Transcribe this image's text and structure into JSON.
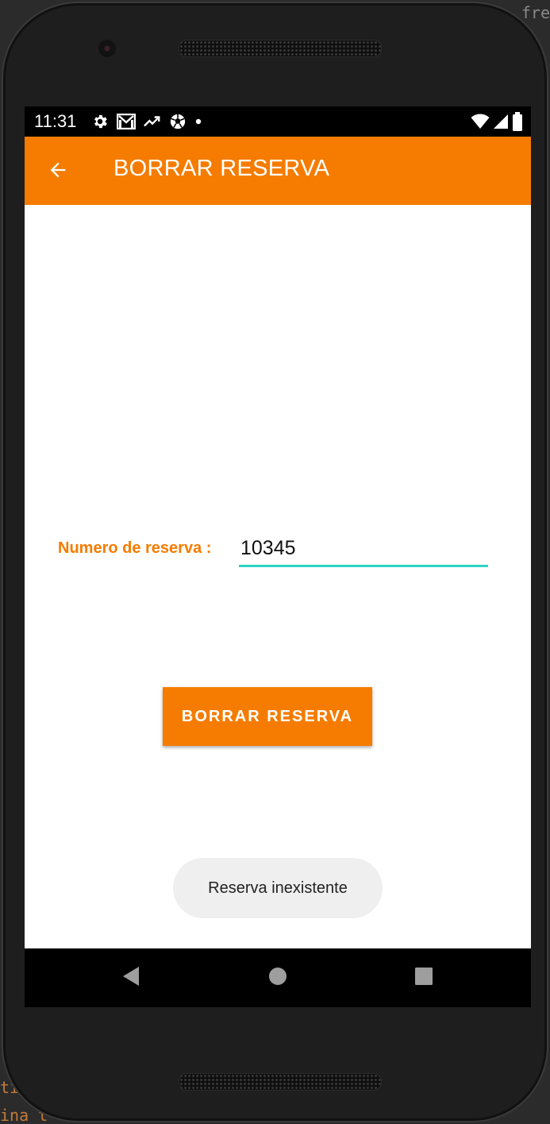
{
  "backdrop": {
    "fragment_top_right": "fre",
    "fragment_bottom_1": "ti",
    "fragment_bottom_2": "ina t"
  },
  "status_bar": {
    "time": "11:31",
    "icons_left": [
      "gear-icon",
      "gmail-icon",
      "trending-icon",
      "soccer-ball-icon",
      "dot-icon"
    ],
    "icons_right": [
      "wifi-icon",
      "cell-signal-icon",
      "battery-icon"
    ]
  },
  "app_bar": {
    "title": "BORRAR RESERVA",
    "back_icon": "arrow-back-icon",
    "background_color": "#f57c00"
  },
  "form": {
    "label": "Numero de reserva :",
    "input_value": "10345",
    "underline_color": "#2dd4c4"
  },
  "actions": {
    "delete_button_label": "BORRAR RESERVA"
  },
  "toast": {
    "message": "Reserva inexistente"
  },
  "nav_bar": {
    "buttons": [
      "back-triangle-icon",
      "home-circle-icon",
      "recents-square-icon"
    ]
  }
}
